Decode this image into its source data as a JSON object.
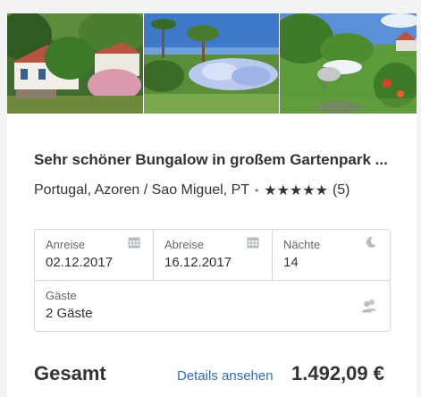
{
  "listing": {
    "title": "Sehr schöner Bungalow in großem Gartenpark ...",
    "location": "Portugal, Azoren / Sao Miguel, PT",
    "separator": "•",
    "rating_stars": "★★★★★",
    "rating": 5,
    "review_count": "(5)"
  },
  "booking": {
    "checkin_label": "Anreise",
    "checkin_value": "02.12.2017",
    "checkout_label": "Abreise",
    "checkout_value": "16.12.2017",
    "nights_label": "Nächte",
    "nights_value": "14",
    "guests_label": "Gäste",
    "guests_value": "2 Gäste"
  },
  "total": {
    "label": "Gesamt",
    "details_link": "Details ansehen",
    "price": "1.492,09 €"
  },
  "icons": {
    "checkin": "calendar-icon",
    "checkout": "calendar-icon",
    "nights": "moon-icon",
    "guests": "users-icon"
  },
  "colors": {
    "link": "#2f6db5",
    "text": "#333333",
    "border": "#d8d8d8",
    "icon": "#b5bcc4"
  }
}
